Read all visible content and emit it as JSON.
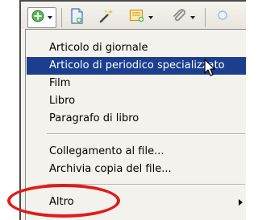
{
  "toolbar": {
    "buttons": [
      {
        "icon": "add-item-icon",
        "has_dropdown": true
      },
      {
        "icon": "new-note-icon",
        "has_dropdown": false
      },
      {
        "icon": "magic-wand-icon",
        "has_dropdown": false
      },
      {
        "icon": "new-note-dropdown-icon",
        "has_dropdown": true
      },
      {
        "icon": "attachment-icon",
        "has_dropdown": true
      }
    ]
  },
  "menu": {
    "items": [
      {
        "label": "Articolo di giornale"
      },
      {
        "label": "Articolo di periodico specializzato",
        "selected": true
      },
      {
        "label": "Film"
      },
      {
        "label": "Libro"
      },
      {
        "label": "Paragrafo di libro"
      }
    ],
    "file_items": [
      {
        "label": "Collegamento al file..."
      },
      {
        "label": "Archivia copia del file..."
      }
    ],
    "more": {
      "label": "Altro",
      "has_submenu": true
    }
  },
  "colors": {
    "selection_bg": "#1c3e8e",
    "annotation": "#e01b1b"
  }
}
